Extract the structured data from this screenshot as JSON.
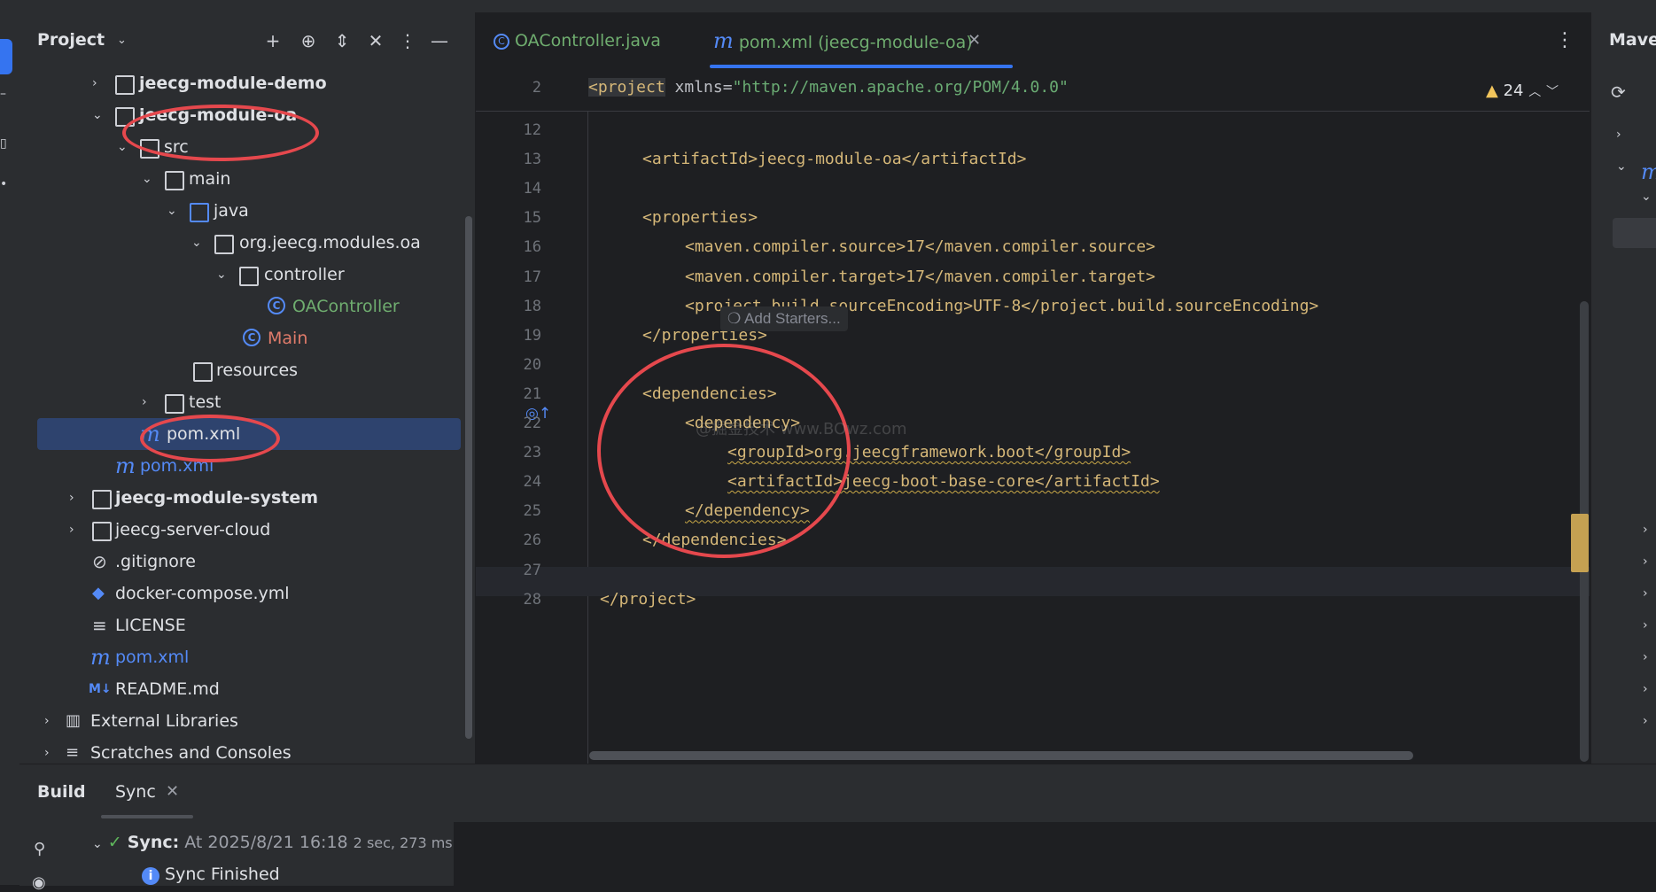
{
  "project_panel": {
    "title": "Project",
    "tree": [
      {
        "label": "jeecg-module-demo",
        "bold": true
      },
      {
        "label": "jeecg-module-oa",
        "bold": true
      },
      {
        "label": "src",
        "bold": false
      },
      {
        "label": "main",
        "bold": false
      },
      {
        "label": "java",
        "bold": false
      },
      {
        "label": "org.jeecg.modules.oa",
        "bold": false
      },
      {
        "label": "controller",
        "bold": false
      },
      {
        "label": "OAController",
        "bold": false
      },
      {
        "label": "Main",
        "bold": false
      },
      {
        "label": "resources",
        "bold": false
      },
      {
        "label": "test",
        "bold": false
      },
      {
        "label": "pom.xml",
        "bold": false
      },
      {
        "label": "pom.xml",
        "bold": false
      },
      {
        "label": "jeecg-module-system",
        "bold": true
      },
      {
        "label": "jeecg-server-cloud",
        "bold": false
      },
      {
        "label": ".gitignore",
        "bold": false
      },
      {
        "label": "docker-compose.yml",
        "bold": false
      },
      {
        "label": "LICENSE",
        "bold": false
      },
      {
        "label": "pom.xml",
        "bold": false
      },
      {
        "label": "README.md",
        "bold": false
      },
      {
        "label": "External Libraries",
        "bold": false
      },
      {
        "label": "Scratches and Consoles",
        "bold": false
      }
    ]
  },
  "editor": {
    "tabs": [
      {
        "label": "OAController.java"
      },
      {
        "label": "pom.xml (jeecg-module-oa)"
      }
    ],
    "warning_count": "24",
    "sticky": {
      "line": "2",
      "tag": "<project",
      "attr": " xmlns=",
      "value": "\"http://maven.apache.org/POM/4.0.0\""
    },
    "lines": [
      {
        "n": "12",
        "indent": 0,
        "code": ""
      },
      {
        "n": "13",
        "indent": 1,
        "code": "<artifactId>jeecg-module-oa</artifactId>"
      },
      {
        "n": "14",
        "indent": 0,
        "code": ""
      },
      {
        "n": "15",
        "indent": 1,
        "code": "<properties>"
      },
      {
        "n": "16",
        "indent": 2,
        "code": "<maven.compiler.source>17</maven.compiler.source>"
      },
      {
        "n": "17",
        "indent": 2,
        "code": "<maven.compiler.target>17</maven.compiler.target>"
      },
      {
        "n": "18",
        "indent": 2,
        "code": "<project.build.sourceEncoding>UTF-8</project.build.sourceEncoding>"
      },
      {
        "n": "19",
        "indent": 1,
        "code": "</properties>"
      },
      {
        "n": "20",
        "indent": 0,
        "code": ""
      },
      {
        "n": "21",
        "indent": 1,
        "code": "<dependencies>"
      },
      {
        "n": "22",
        "indent": 2,
        "code": "<dependency>"
      },
      {
        "n": "23",
        "indent": 3,
        "code": "<groupId>org.jeecgframework.boot</groupId>"
      },
      {
        "n": "24",
        "indent": 3,
        "code": "<artifactId>jeecg-boot-base-core</artifactId>"
      },
      {
        "n": "25",
        "indent": 2,
        "code": "</dependency>"
      },
      {
        "n": "26",
        "indent": 1,
        "code": "</dependencies>"
      },
      {
        "n": "27",
        "indent": 0,
        "code": ""
      },
      {
        "n": "28",
        "indent": 0,
        "code": "</project>"
      }
    ],
    "inlay_hint": "Add Starters...",
    "watermark": "@掘金技术 www.BOwz.com"
  },
  "maven_panel": {
    "title": "Maven"
  },
  "build_panel": {
    "build_tab": "Build",
    "sync_tab": "Sync",
    "sync_label": "Sync:",
    "sync_time": " At 2025/8/21 16:18 ",
    "sync_duration": "2 sec, 273 ms",
    "finished": "Sync Finished"
  },
  "colors": {
    "accent": "#3574f0",
    "annotation": "#e5484d",
    "tag": "#d5b778",
    "string": "#6aab73"
  }
}
